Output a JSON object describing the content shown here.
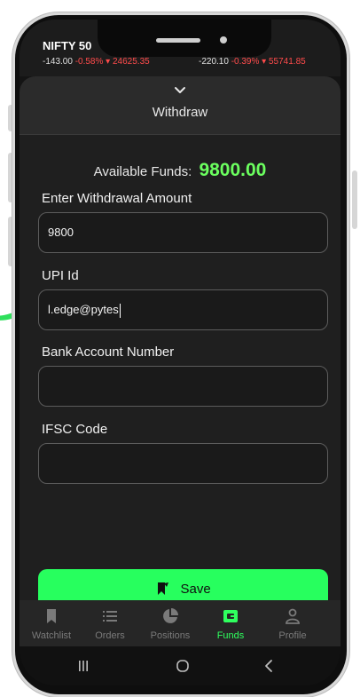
{
  "ticker": {
    "name": "NIFTY 50",
    "nifty_change": "-143.00",
    "nifty_pct": "-0.58%",
    "nifty_value": "24625.35",
    "second_change": "-220.10",
    "second_pct": "-0.39%",
    "second_value": "55741.85"
  },
  "sheet": {
    "title": "Withdraw",
    "available_label": "Available Funds:",
    "available_value": "9800.00"
  },
  "form": {
    "amount_label": "Enter Withdrawal Amount",
    "amount_value": "9800",
    "upi_label": "UPI Id",
    "upi_value": "l.edge@pytes",
    "bank_label": "Bank Account Number",
    "bank_value": "",
    "ifsc_label": "IFSC Code",
    "ifsc_value": "",
    "save_label": "Save"
  },
  "nav": {
    "items": [
      {
        "label": "Watchlist",
        "icon": "bookmark-icon"
      },
      {
        "label": "Orders",
        "icon": "list-icon"
      },
      {
        "label": "Positions",
        "icon": "pie-chart-icon"
      },
      {
        "label": "Funds",
        "icon": "wallet-icon"
      },
      {
        "label": "Profile",
        "icon": "user-icon"
      }
    ],
    "active": "Funds"
  },
  "colors": {
    "accent": "#27ff5e",
    "negative": "#ff4b4b",
    "background": "#1f1f1f"
  }
}
